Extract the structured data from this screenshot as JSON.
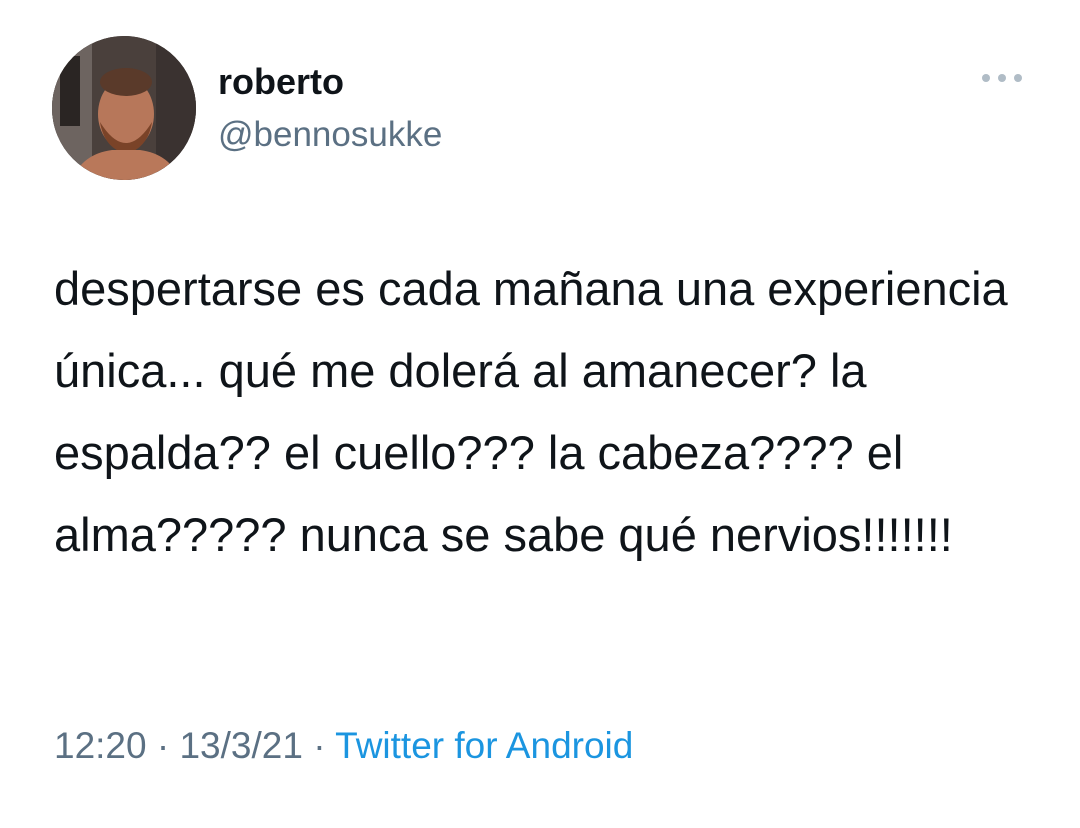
{
  "author": {
    "display_name": "roberto",
    "handle": "@bennosukke",
    "avatar_icon": "avatar-photo"
  },
  "menu": {
    "icon": "more-dots-icon"
  },
  "tweet": {
    "text": "despertarse es cada mañana una experiencia única... qué me dolerá al amanecer? la espalda?? el cuello??? la cabeza???? el alma????? nunca se sabe qué nervios!!!!!!!"
  },
  "meta": {
    "time": "12:20",
    "separator_1": " · ",
    "date": "13/3/21",
    "separator_2": " · ",
    "source": "Twitter for Android"
  },
  "colors": {
    "text": "#0f1419",
    "secondary": "#5b7083",
    "link": "#1b95e0"
  }
}
